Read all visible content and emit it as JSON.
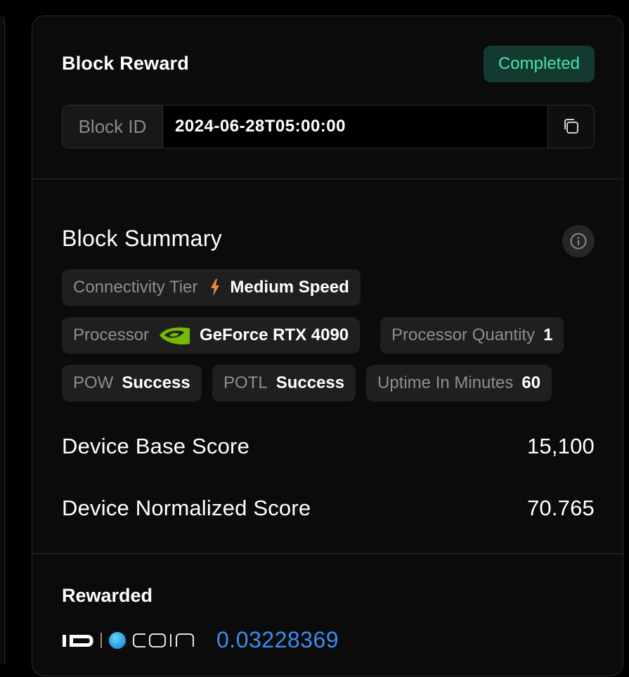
{
  "header": {
    "title": "Block Reward",
    "status": "Completed"
  },
  "block_id": {
    "label": "Block ID",
    "value": "2024-06-28T05:00:00"
  },
  "summary": {
    "title": "Block Summary",
    "connectivity": {
      "label": "Connectivity Tier",
      "value": "Medium Speed"
    },
    "processor": {
      "label": "Processor",
      "value": "GeForce RTX 4090"
    },
    "processor_quantity": {
      "label": "Processor Quantity",
      "value": "1"
    },
    "pow": {
      "label": "POW",
      "value": "Success"
    },
    "potl": {
      "label": "POTL",
      "value": "Success"
    },
    "uptime": {
      "label": "Uptime In Minutes",
      "value": "60"
    },
    "base_score": {
      "label": "Device Base Score",
      "value": "15,100"
    },
    "normalized_score": {
      "label": "Device Normalized Score",
      "value": "70.765"
    }
  },
  "reward": {
    "title": "Rewarded",
    "amount": "0.03228369"
  },
  "colors": {
    "status_text": "#4ee3a6",
    "status_bg": "#123a30",
    "reward_amount": "#3b8df0",
    "bolt": "#f08a3a",
    "nvidia_green": "#76b900"
  },
  "icons": [
    "copy-icon",
    "info-icon",
    "lightning-icon",
    "nvidia-logo-icon",
    "io-logo-icon",
    "coin-logo-icon"
  ]
}
